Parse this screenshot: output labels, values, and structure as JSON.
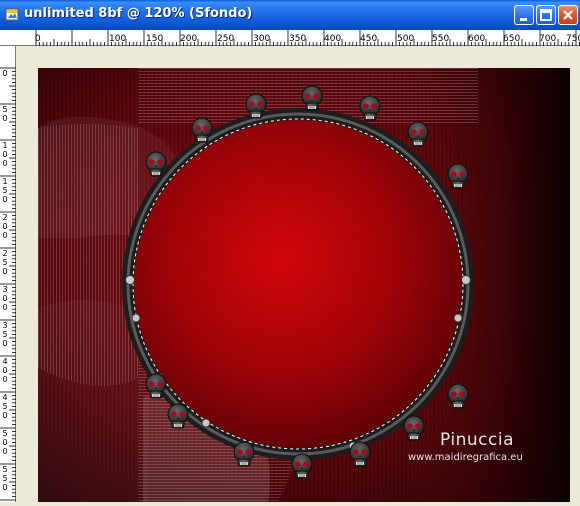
{
  "window": {
    "title": "unlimited 8bf @ 120% (Sfondo)",
    "buttons": [
      "minimize",
      "maximize",
      "close"
    ]
  },
  "ruler": {
    "top_labels": [
      "0",
      "100",
      "150",
      "200",
      "250",
      "300",
      "350",
      "400",
      "450",
      "500",
      "550",
      "600",
      "650",
      "700",
      "750"
    ],
    "top_short": [
      "0",
      "100",
      "150",
      "200",
      "250",
      "300",
      "350",
      "400",
      "450",
      "500",
      "550",
      "600",
      "650",
      "700",
      "750"
    ],
    "left_labels": [
      [
        "0"
      ],
      [
        "5",
        "0"
      ],
      [
        "1",
        "0",
        "0"
      ],
      [
        "1",
        "5",
        "0"
      ],
      [
        "2",
        "0",
        "0"
      ],
      [
        "2",
        "5",
        "0"
      ],
      [
        "3",
        "0",
        "0"
      ],
      [
        "3",
        "5",
        "0"
      ],
      [
        "4",
        "0",
        "0"
      ],
      [
        "4",
        "5",
        "0"
      ],
      [
        "5",
        "0",
        "0"
      ],
      [
        "5",
        "5",
        "0"
      ]
    ]
  },
  "canvas": {
    "colors": {
      "deep": "#3a0006",
      "mid": "#8e0d12",
      "bright": "#c00406",
      "dark": "#120003"
    }
  },
  "watermark": {
    "name": "Pinuccia",
    "url": "www.maidiregrafica.eu"
  }
}
